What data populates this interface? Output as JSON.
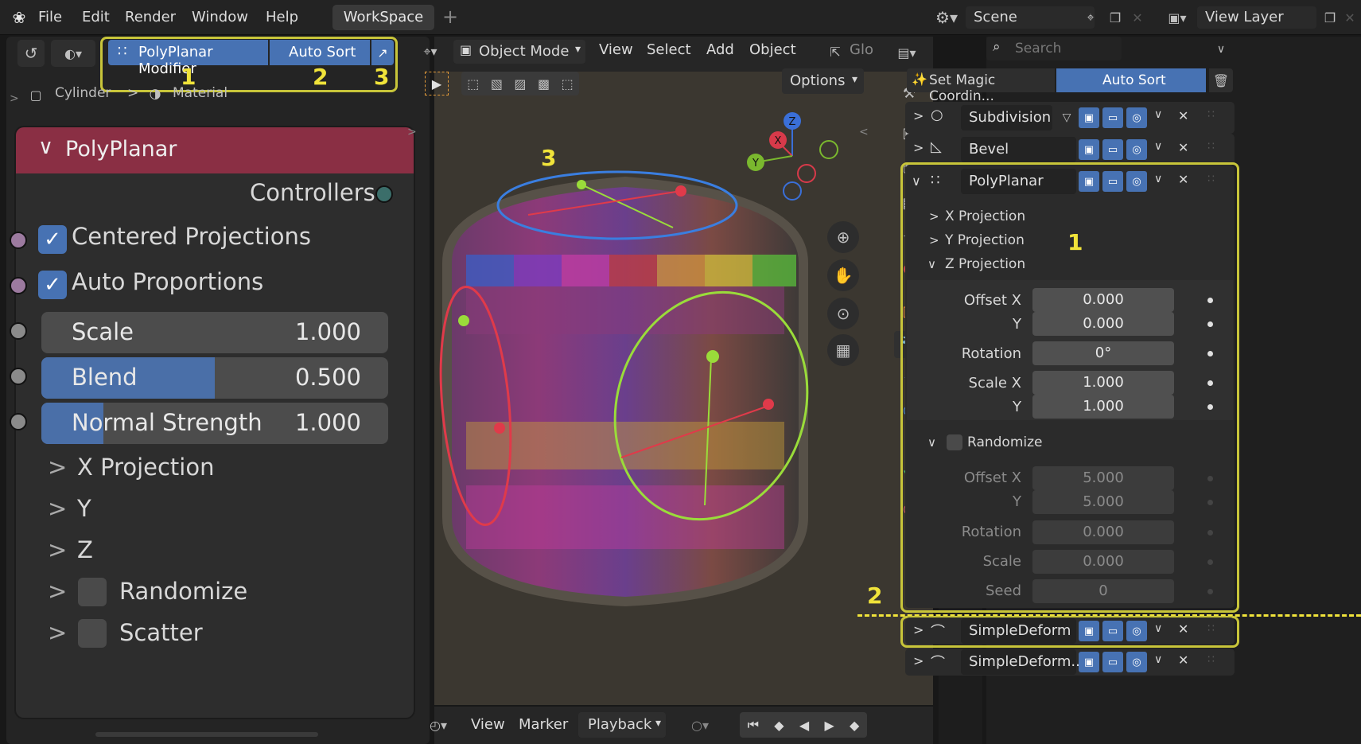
{
  "menu": {
    "items": [
      "File",
      "Edit",
      "Render",
      "Window",
      "Help"
    ],
    "workspace": "WorkSpace",
    "add": "+"
  },
  "scene": {
    "label": "Scene",
    "view_layer": "View Layer"
  },
  "left": {
    "addon_button": "PolyPlanar Modifier",
    "autosort_button": "Auto Sort",
    "num1": "1",
    "num2": "2",
    "num3": "3",
    "breadcrumb_object": "Cylinder",
    "breadcrumb_sep": ">",
    "breadcrumb_material": "Material"
  },
  "node": {
    "title": "PolyPlanar",
    "controllers": "Controllers",
    "centered": "Centered Projections",
    "auto_prop": "Auto Proportions",
    "scale_label": "Scale",
    "scale_value": "1.000",
    "scale_fill": 0,
    "blend_label": "Blend",
    "blend_value": "0.500",
    "blend_fill": 0.5,
    "normal_label": "Normal Strength",
    "normal_value": "1.000",
    "normal_fill": 0.18,
    "xproj": "X Projection",
    "y": "Y",
    "z": "Z",
    "randomize": "Randomize",
    "scatter": "Scatter"
  },
  "viewport": {
    "mode": "Object Mode",
    "menus": [
      "View",
      "Select",
      "Add",
      "Object"
    ],
    "glo": "Glo",
    "options": "Options",
    "annot3": "3",
    "timeline": [
      "View",
      "Marker",
      "Playback"
    ]
  },
  "props": {
    "search": "Search",
    "magic": "Set Magic Coordin...",
    "autosort": "Auto Sort",
    "mods": {
      "subdiv": "Subdivision",
      "bevel": "Bevel",
      "poly": "PolyPlanar",
      "simple": "SimpleDeform",
      "simple2": "SimpleDeform...."
    },
    "xproj": "X Projection",
    "yproj": "Y Projection",
    "zproj": "Z Projection",
    "offx": "Offset X",
    "y": "Y",
    "rotation": "Rotation",
    "scalex": "Scale X",
    "scale": "Scale",
    "seed": "Seed",
    "randomize": "Randomize",
    "v_offx": "0.000",
    "v_offy": "0.000",
    "v_rot": "0°",
    "v_sx": "1.000",
    "v_sy": "1.000",
    "r_offx": "5.000",
    "r_offy": "5.000",
    "r_rot": "0.000",
    "r_scale": "0.000",
    "r_seed": "0",
    "annot1": "1",
    "annot2": "2"
  },
  "colors": {
    "accent": "#4772b3",
    "header_red": "#8a2f44",
    "highlight": "#c8c53a"
  }
}
